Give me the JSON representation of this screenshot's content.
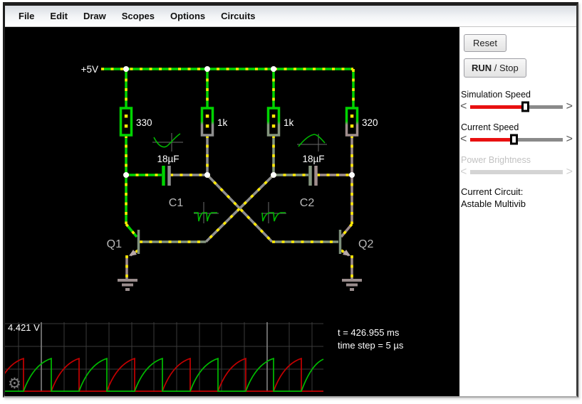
{
  "menu": {
    "items": [
      "File",
      "Edit",
      "Draw",
      "Scopes",
      "Options",
      "Circuits"
    ]
  },
  "circuit": {
    "supply": "+5V",
    "resistors": [
      "330",
      "1k",
      "1k",
      "320"
    ],
    "cap_values": [
      "18µF",
      "18µF"
    ],
    "cap_names": [
      "C1",
      "C2"
    ],
    "transistor_names": [
      "Q1",
      "Q2"
    ]
  },
  "scope": {
    "voltage": "4.421 V",
    "time": "t = 426.955 ms",
    "time_step": "time step = 5 µs",
    "gear_glyph": "⚙"
  },
  "sidebar": {
    "reset": "Reset",
    "run": "RUN",
    "stop": " / Stop",
    "circuit_title": "Current Circuit:",
    "circuit_name": "Astable Multivib",
    "sliders": [
      {
        "label": "Simulation Speed",
        "left_arrow": "<",
        "right_arrow": ">",
        "value_pct": 60,
        "enabled": true
      },
      {
        "label": "Current Speed",
        "left_arrow": "<",
        "right_arrow": ">",
        "value_pct": 48,
        "enabled": true
      },
      {
        "label": "Power Brightness",
        "left_arrow": "<",
        "right_arrow": ">",
        "value_pct": 0,
        "enabled": false
      }
    ]
  },
  "colors": {
    "wire_positive_green": "#00d400",
    "wire_neutral_gray": "#8f8f8f",
    "current_dot_yellow": "#ffe900",
    "trace_red": "#c40000",
    "trace_green": "#00bb00",
    "slider_fill_red": "#e81010",
    "canvas_background": "#000000"
  }
}
